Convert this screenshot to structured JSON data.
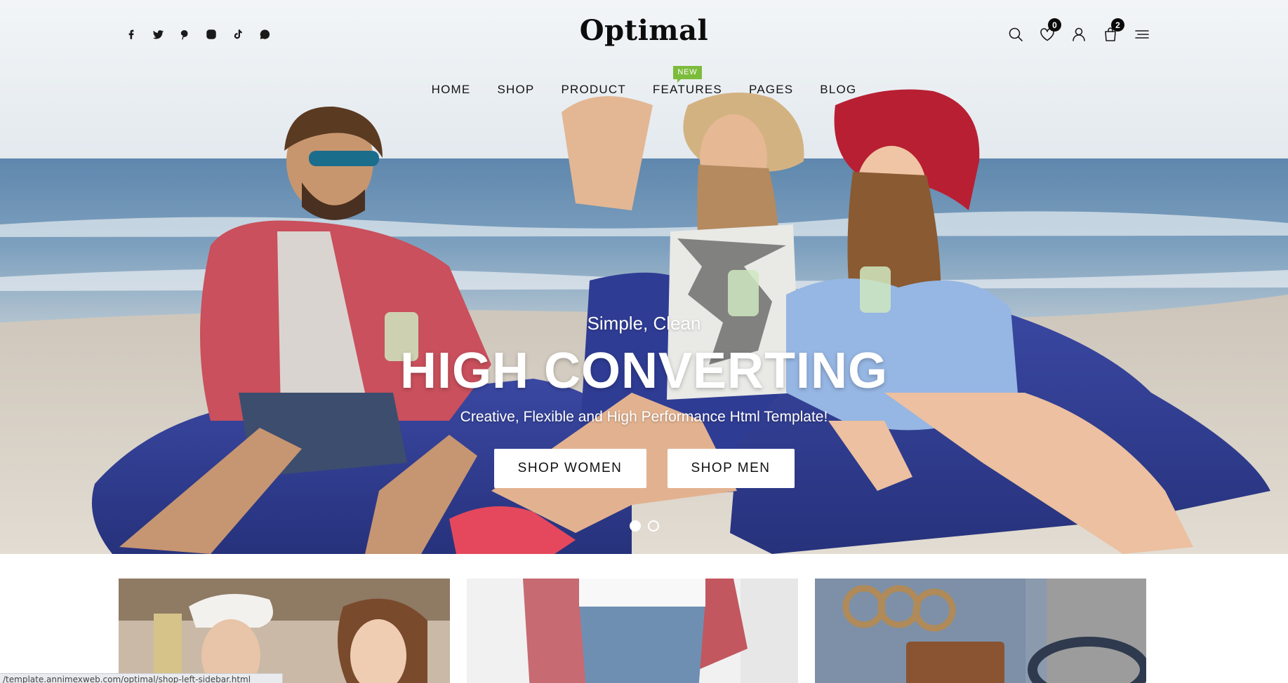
{
  "header": {
    "logo": "Optimal",
    "social_icons": [
      "facebook-icon",
      "twitter-icon",
      "pinterest-icon",
      "instagram-icon",
      "tiktok-icon",
      "whatsapp-icon"
    ],
    "tools": {
      "search_icon": "search-icon",
      "wishlist_icon": "heart-icon",
      "wishlist_count": "0",
      "account_icon": "user-icon",
      "cart_icon": "shopping-bag-icon",
      "cart_count": "2",
      "menu_icon": "menu-icon"
    }
  },
  "nav": {
    "items": [
      {
        "label": "HOME"
      },
      {
        "label": "SHOP"
      },
      {
        "label": "PRODUCT"
      },
      {
        "label": "FEATURES",
        "badge": "NEW"
      },
      {
        "label": "PAGES"
      },
      {
        "label": "BLOG"
      }
    ],
    "badge_color": "#7cbb3c"
  },
  "hero": {
    "subtitle": "Simple, Clean",
    "title": "HIGH CONVERTING",
    "description": "Creative, Flexible and High Performance Html Template!",
    "buttons": {
      "women": "SHOP WOMEN",
      "men": "SHOP MEN"
    },
    "slides": {
      "count": 2,
      "active": 1
    }
  },
  "status_bar": {
    "url": "/template.annimexweb.com/optimal/shop-left-sidebar.html"
  },
  "colors": {
    "text": "#111111",
    "badge_new": "#7cbb3c",
    "count_badge": "#0a0a0a",
    "hero_text": "#ffffff",
    "button_bg": "#ffffff"
  }
}
